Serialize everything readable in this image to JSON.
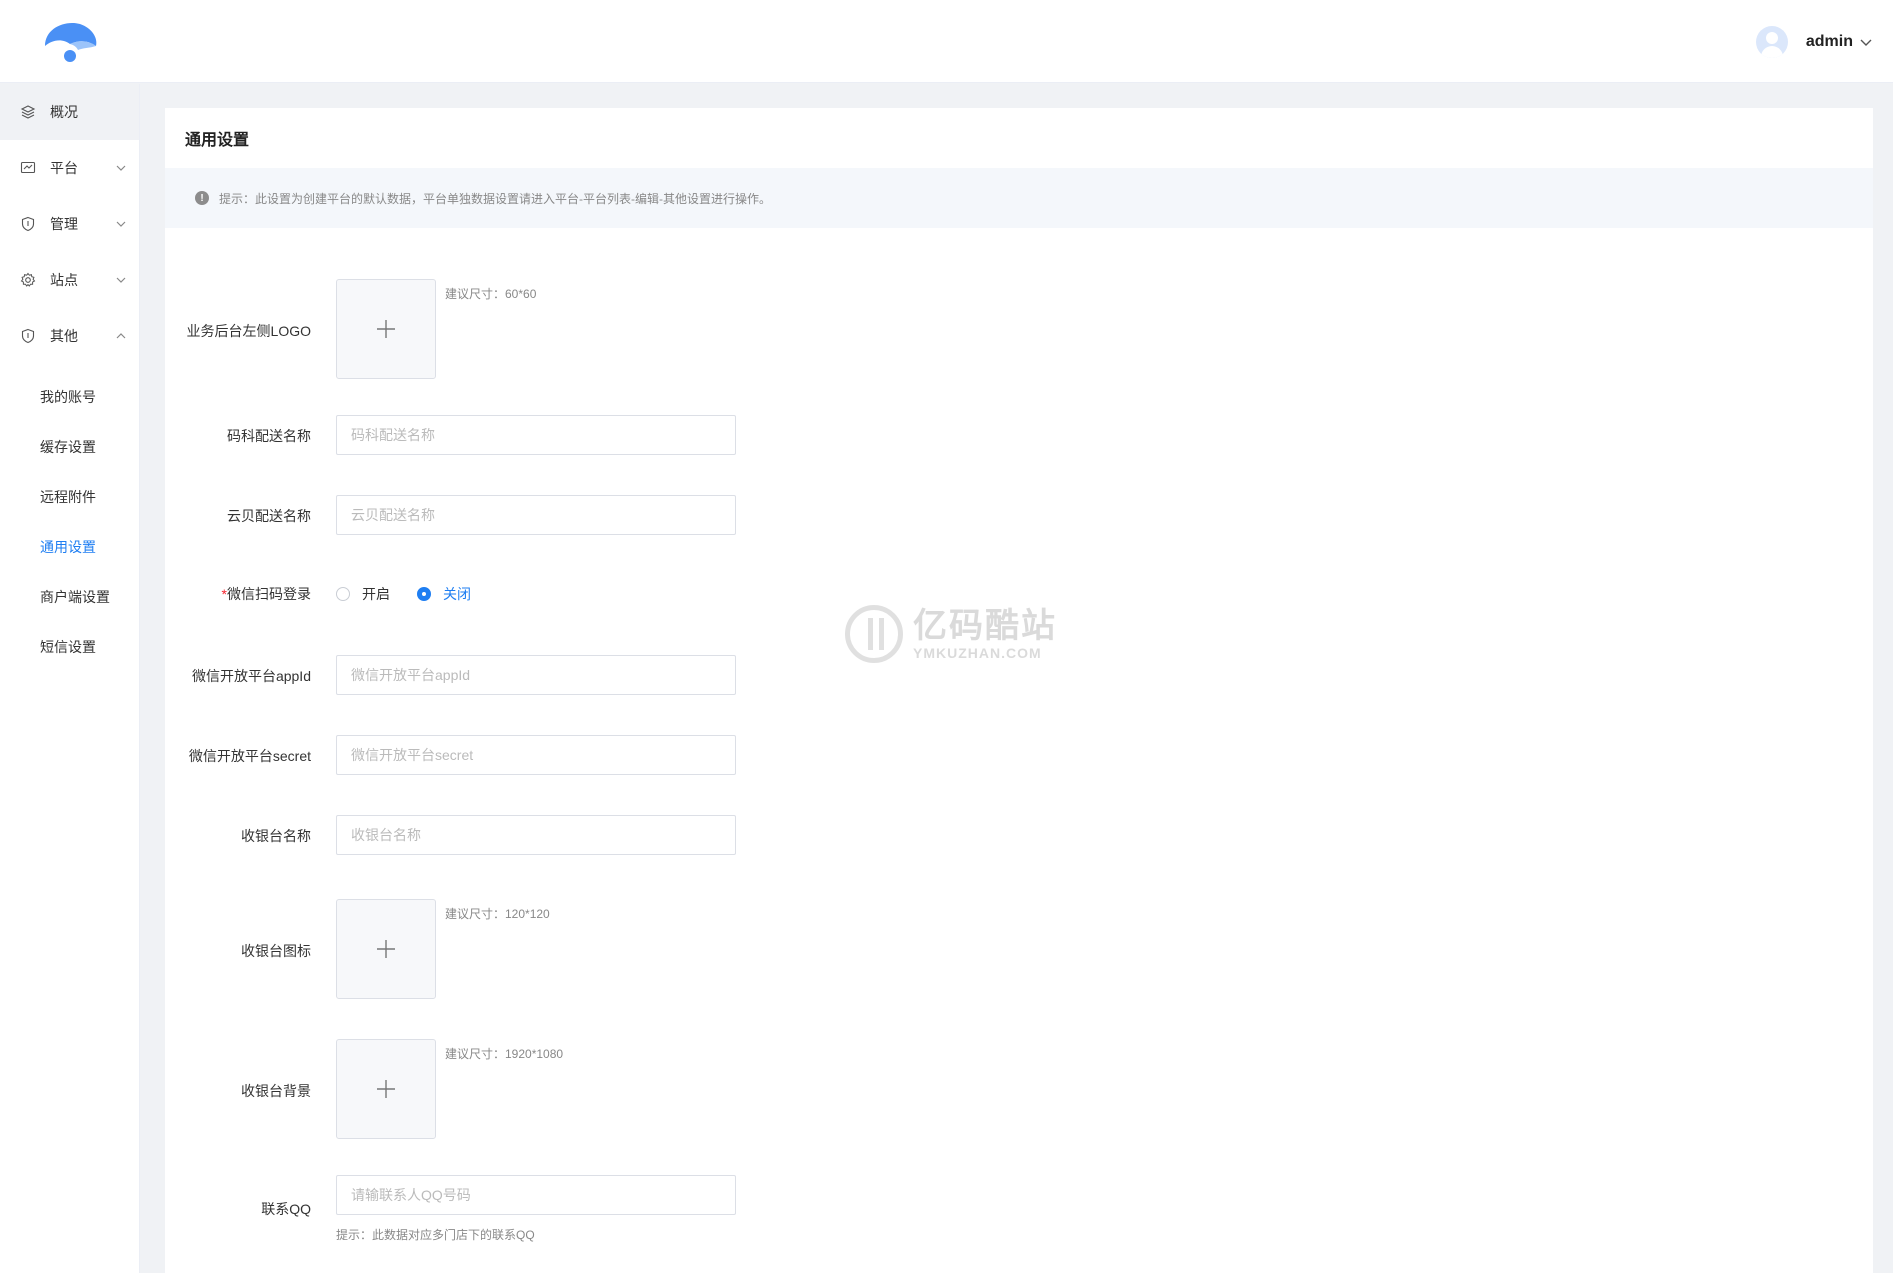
{
  "header": {
    "username": "admin"
  },
  "sidebar": {
    "items": [
      {
        "label": "概况",
        "icon": "layers-icon"
      },
      {
        "label": "平台",
        "icon": "chart-icon"
      },
      {
        "label": "管理",
        "icon": "shield-icon"
      },
      {
        "label": "站点",
        "icon": "gear-icon"
      },
      {
        "label": "其他",
        "icon": "shield-icon"
      }
    ],
    "sub_items": [
      {
        "label": "我的账号"
      },
      {
        "label": "缓存设置"
      },
      {
        "label": "远程附件"
      },
      {
        "label": "通用设置"
      },
      {
        "label": "商户端设置"
      },
      {
        "label": "短信设置"
      }
    ]
  },
  "page": {
    "title": "通用设置",
    "tip": "提示：此设置为创建平台的默认数据，平台单独数据设置请进入平台-平台列表-编辑-其他设置进行操作。"
  },
  "form": {
    "logo": {
      "label": "业务后台左侧LOGO",
      "hint": "建议尺寸：60*60"
    },
    "maker_name": {
      "label": "码科配送名称",
      "placeholder": "码科配送名称"
    },
    "yunbei_name": {
      "label": "云贝配送名称",
      "placeholder": "云贝配送名称"
    },
    "wechat_login": {
      "label": "微信扫码登录",
      "required_mark": "*",
      "option_on": "开启",
      "option_off": "关闭",
      "selected": "关闭"
    },
    "wechat_appid": {
      "label": "微信开放平台appId",
      "placeholder": "微信开放平台appId"
    },
    "wechat_secret": {
      "label": "微信开放平台secret",
      "placeholder": "微信开放平台secret"
    },
    "cashier_name": {
      "label": "收银台名称",
      "placeholder": "收银台名称"
    },
    "cashier_icon": {
      "label": "收银台图标",
      "hint": "建议尺寸：120*120"
    },
    "cashier_bg": {
      "label": "收银台背景",
      "hint": "建议尺寸：1920*1080"
    },
    "contact_qq": {
      "label": "联系QQ",
      "placeholder": "请输联系人QQ号码",
      "hint": "提示：此数据对应多门店下的联系QQ"
    }
  },
  "watermark": {
    "cn": "亿码酷站",
    "en": "YMKUZHAN.COM"
  },
  "colors": {
    "accent": "#1e7ef2",
    "logo": "#4a90f5"
  }
}
